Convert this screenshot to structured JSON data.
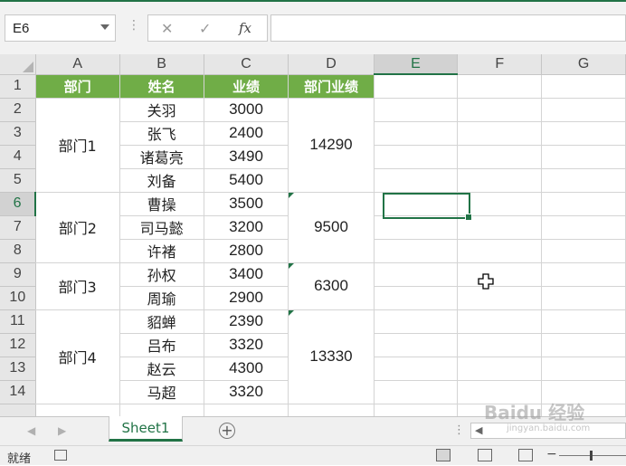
{
  "formula_bar": {
    "name_box": "E6",
    "cancel_glyph": "✕",
    "enter_glyph": "✓",
    "fx_label": "fx",
    "formula_value": ""
  },
  "columns": [
    "A",
    "B",
    "C",
    "D",
    "E",
    "F",
    "G"
  ],
  "selected_column": "E",
  "rows": [
    "1",
    "2",
    "3",
    "4",
    "5",
    "6",
    "7",
    "8",
    "9",
    "10",
    "11",
    "12",
    "13",
    "14"
  ],
  "selected_row": "6",
  "header_row": {
    "A": "部门",
    "B": "姓名",
    "C": "业绩",
    "D": "部门业绩"
  },
  "departments": [
    {
      "name": "部门1",
      "total": "14290",
      "members": [
        {
          "name": "关羽",
          "score": "3000"
        },
        {
          "name": "张飞",
          "score": "2400"
        },
        {
          "name": "诸葛亮",
          "score": "3490"
        },
        {
          "name": "刘备",
          "score": "5400"
        }
      ]
    },
    {
      "name": "部门2",
      "total": "9500",
      "members": [
        {
          "name": "曹操",
          "score": "3500"
        },
        {
          "name": "司马懿",
          "score": "3200"
        },
        {
          "name": "许褚",
          "score": "2800"
        }
      ]
    },
    {
      "name": "部门3",
      "total": "6300",
      "members": [
        {
          "name": "孙权",
          "score": "3400"
        },
        {
          "name": "周瑜",
          "score": "2900"
        }
      ]
    },
    {
      "name": "部门4",
      "total": "13330",
      "members": [
        {
          "name": "貂蝉",
          "score": "2390"
        },
        {
          "name": "吕布",
          "score": "3320"
        },
        {
          "name": "赵云",
          "score": "4300"
        },
        {
          "name": "马超",
          "score": "3320"
        }
      ]
    }
  ],
  "sheet_tabs": [
    "Sheet1"
  ],
  "status": {
    "ready": "就绪"
  },
  "watermark": {
    "main": "Baidu 经验",
    "sub": "jingyan.baidu.com"
  },
  "colors": {
    "accent": "#217346",
    "header_fill": "#70ad47"
  },
  "icons": {
    "namebox_dropdown": "chevron-down-icon",
    "add_sheet": "plus-circle-icon",
    "cursor": "cross-cursor-icon"
  }
}
